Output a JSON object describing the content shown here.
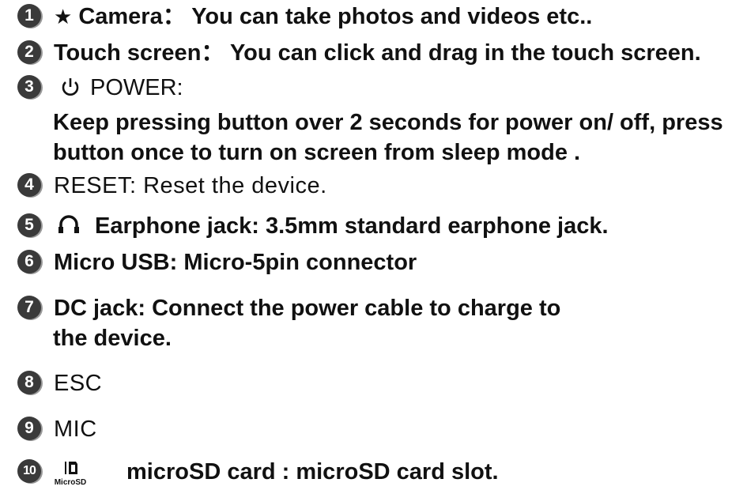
{
  "items": [
    {
      "num": "1",
      "text": "Camera： You can take photos and videos etc..",
      "icon": "star-icon"
    },
    {
      "num": "2",
      "text": "Touch screen： You can click and drag in the touch screen."
    },
    {
      "num": "3",
      "text": "POWER:",
      "icon": "power-icon",
      "lines": [
        "Keep pressing button over 2 seconds for power on/ off, press",
        "button once to turn on screen from sleep mode ."
      ]
    },
    {
      "num": "4",
      "text": "RESET: Reset the device."
    },
    {
      "num": "5",
      "text": "Earphone jack: 3.5mm standard earphone jack.",
      "icon": "headphone-icon"
    },
    {
      "num": "6",
      "text": "Micro USB: Micro-5pin connector"
    },
    {
      "num": "7",
      "text": "DC jack: Connect the power cable to charge to",
      "lines": [
        "the device."
      ]
    },
    {
      "num": "8",
      "text": "ESC"
    },
    {
      "num": "9",
      "text": "MIC"
    },
    {
      "num": "10",
      "text": "microSD card : microSD card slot.",
      "icon": "microsd-icon",
      "icon_label": "MicroSD"
    }
  ]
}
